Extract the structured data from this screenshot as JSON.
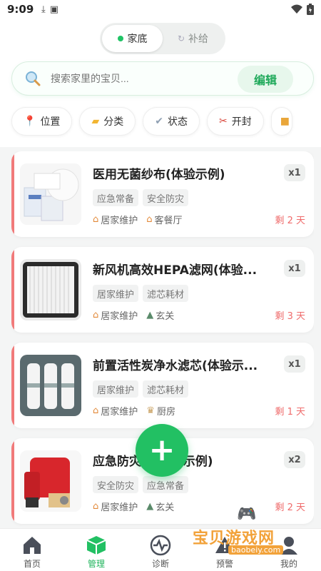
{
  "status_bar": {
    "time": "9:09",
    "download_icon": "download-icon",
    "sim_icon": "sim-icon",
    "wifi_icon": "wifi-icon",
    "battery_icon": "battery-icon"
  },
  "segment": {
    "options": [
      {
        "label": "家底",
        "active": true
      },
      {
        "label": "补给",
        "active": false
      }
    ]
  },
  "search": {
    "placeholder": "搜索家里的宝贝...",
    "edit_label": "编辑"
  },
  "filters": [
    {
      "label": "位置",
      "icon": "pin-icon"
    },
    {
      "label": "分类",
      "icon": "folder-icon"
    },
    {
      "label": "状态",
      "icon": "check-icon"
    },
    {
      "label": "开封",
      "icon": "scissors-icon"
    },
    {
      "label": "",
      "icon": "box-icon"
    }
  ],
  "items": [
    {
      "title": "医用无菌纱布(体验示例)",
      "qty": "x1",
      "tags": [
        "应急常备",
        "安全防灾"
      ],
      "loc1": "居家维护",
      "loc2": "客餐厅",
      "remain": "剩 2 天"
    },
    {
      "title": "新风机高效HEPA滤网(体验...",
      "qty": "x1",
      "tags": [
        "居家维护",
        "滤芯耗材"
      ],
      "loc1": "居家维护",
      "loc2": "玄关",
      "remain": "剩 3 天"
    },
    {
      "title": "前置活性炭净水滤芯(体验示...",
      "qty": "x1",
      "tags": [
        "居家维护",
        "滤芯耗材"
      ],
      "loc1": "居家维护",
      "loc2": "厨房",
      "remain": "剩 1 天"
    },
    {
      "title": "应急防灾包(体验示例)",
      "qty": "x2",
      "tags": [
        "安全防灾",
        "应急常备"
      ],
      "loc1": "居家维护",
      "loc2": "玄关",
      "remain": "剩 2 天"
    }
  ],
  "fab": {
    "label": "+"
  },
  "tabs": [
    {
      "label": "首页",
      "icon": "home-icon",
      "active": false
    },
    {
      "label": "管理",
      "icon": "cube-icon",
      "active": true
    },
    {
      "label": "诊断",
      "icon": "pulse-icon",
      "active": false
    },
    {
      "label": "预警",
      "icon": "alert-icon",
      "active": false
    },
    {
      "label": "我的",
      "icon": "user-icon",
      "active": false
    }
  ],
  "watermark": {
    "text": "宝贝游戏网",
    "url": "baobeiy.com"
  },
  "colors": {
    "accent": "#22c063",
    "danger": "#ef6b6b",
    "edit_bg": "#e7f7ec"
  }
}
